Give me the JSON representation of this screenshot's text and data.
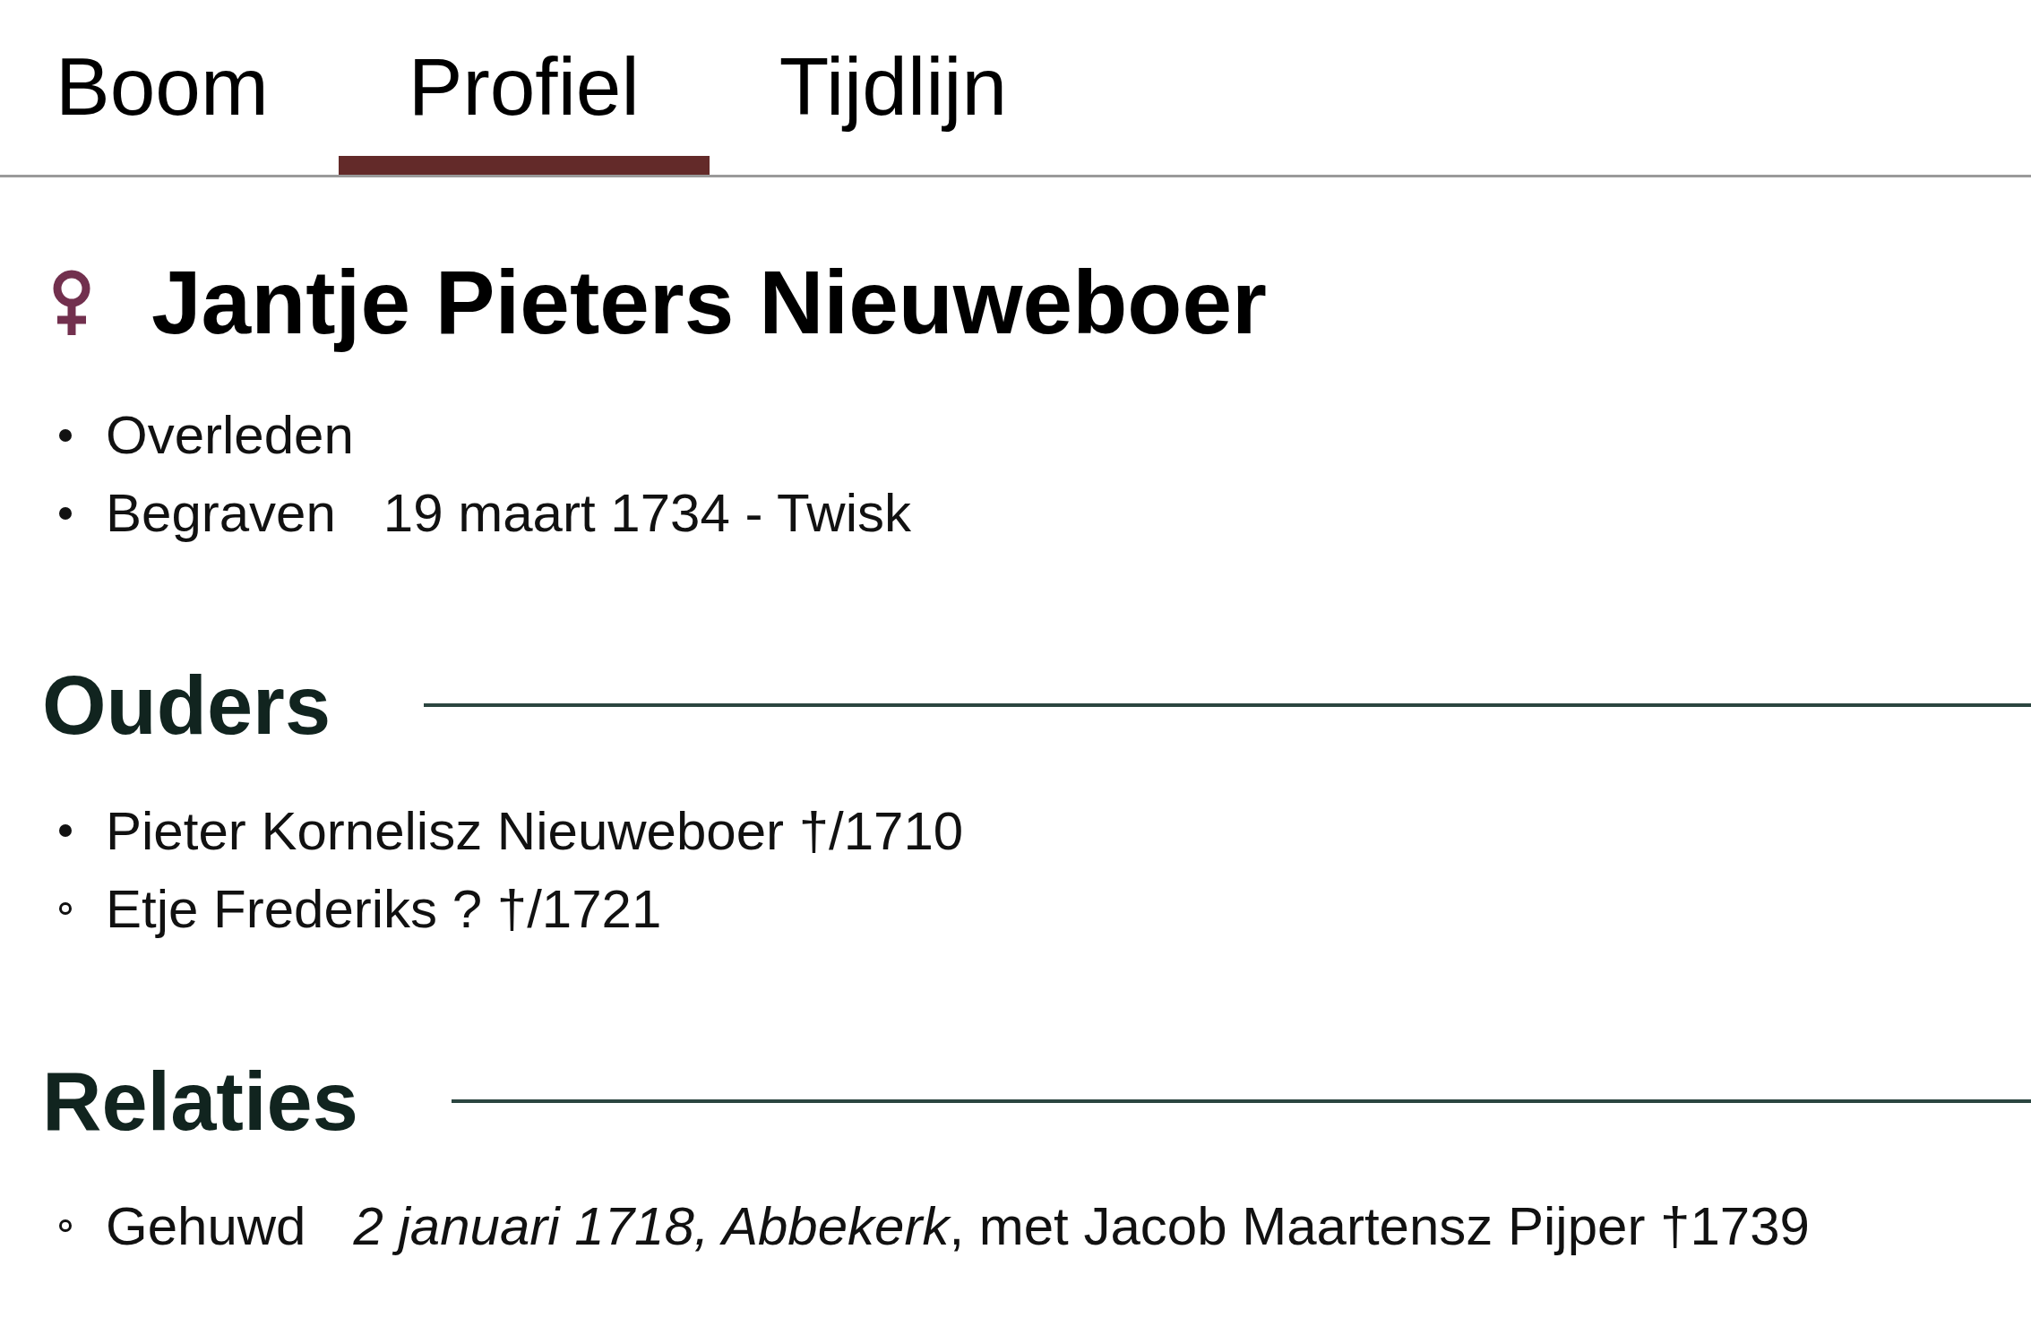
{
  "tabs": [
    {
      "label": "Boom",
      "selected": false
    },
    {
      "label": "Profiel",
      "selected": true
    },
    {
      "label": "Tijdlijn",
      "selected": false
    }
  ],
  "profile": {
    "name": "Jantje Pieters Nieuweboer",
    "events": [
      {
        "kind": "disc",
        "label": "Overleden"
      },
      {
        "kind": "disc",
        "label": "Begraven",
        "value": "19 maart 1734 - Twisk"
      }
    ]
  },
  "sections": [
    {
      "title": "Ouders",
      "items": [
        {
          "kind": "disc",
          "text": "Pieter Kornelisz Nieuweboer †/1710"
        },
        {
          "kind": "circle",
          "text": "Etje Frederiks ? †/1721"
        }
      ]
    },
    {
      "title": "Relaties",
      "items": [
        {
          "kind": "circle",
          "label": "Gehuwd",
          "value": "*2 januari 1718, Abbekerk*, met Jacob Maartensz Pijper †1739"
        }
      ]
    }
  ]
}
